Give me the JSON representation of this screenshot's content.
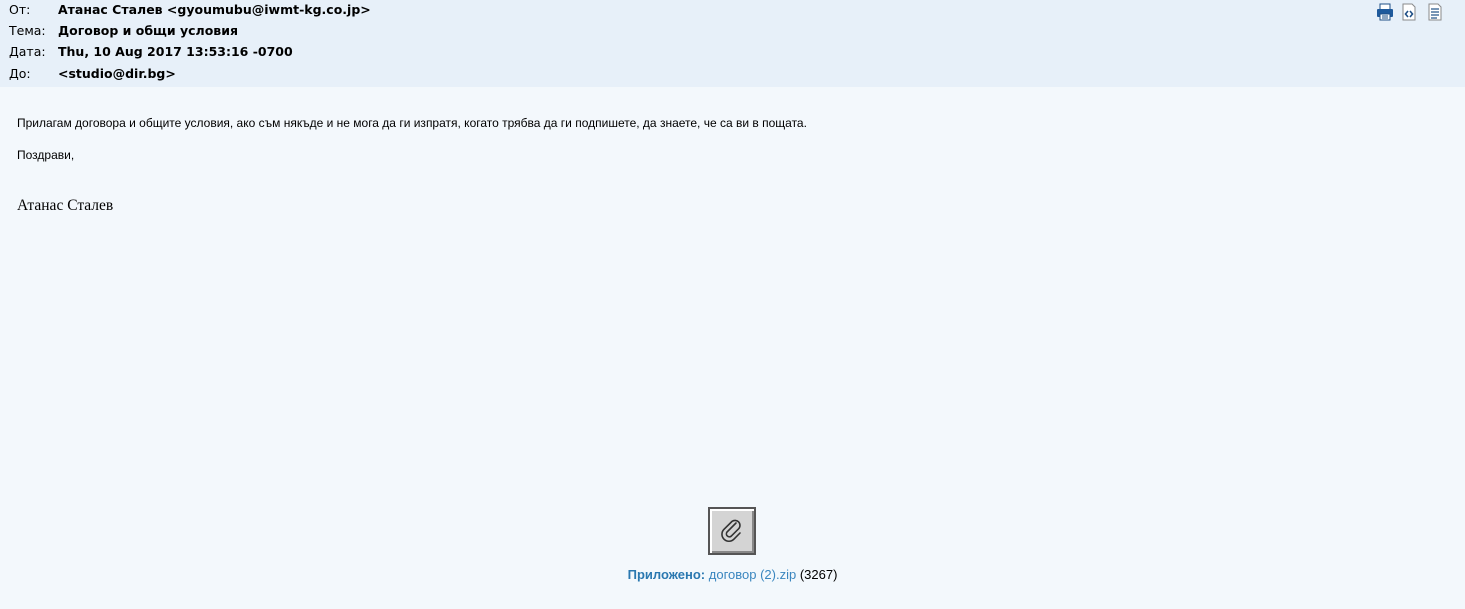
{
  "header": {
    "from_label": "От:",
    "from_value": "Атанас Сталев <gyoumubu@iwmt-kg.co.jp>",
    "subject_label": "Тема:",
    "subject_value": "Договор и общи условия",
    "date_label": "Дата:",
    "date_value": "Thu, 10 Aug 2017 13:53:16 -0700",
    "to_label": "До:",
    "to_value": "<studio@dir.bg>"
  },
  "toolbar": {
    "icons": [
      "print-icon",
      "view-source-icon",
      "headers-icon"
    ]
  },
  "message": {
    "paragraph": "Прилагам договора и общите условия, ако съм някъде и не мога да ги изпратя, когато трябва да ги подпишете, да знаете, че са ви в пощата.",
    "greeting": "Поздрави,",
    "signature": "Атанас Сталев"
  },
  "attachment": {
    "label": "Приложено:",
    "filename": "договор (2).zip",
    "size": "(3267)",
    "icon": "paperclip-icon"
  },
  "colors": {
    "header_bg": "#e7f0f9",
    "body_bg": "#f3f8fc",
    "link": "#3a86bf",
    "attach_label": "#2a78b0"
  }
}
